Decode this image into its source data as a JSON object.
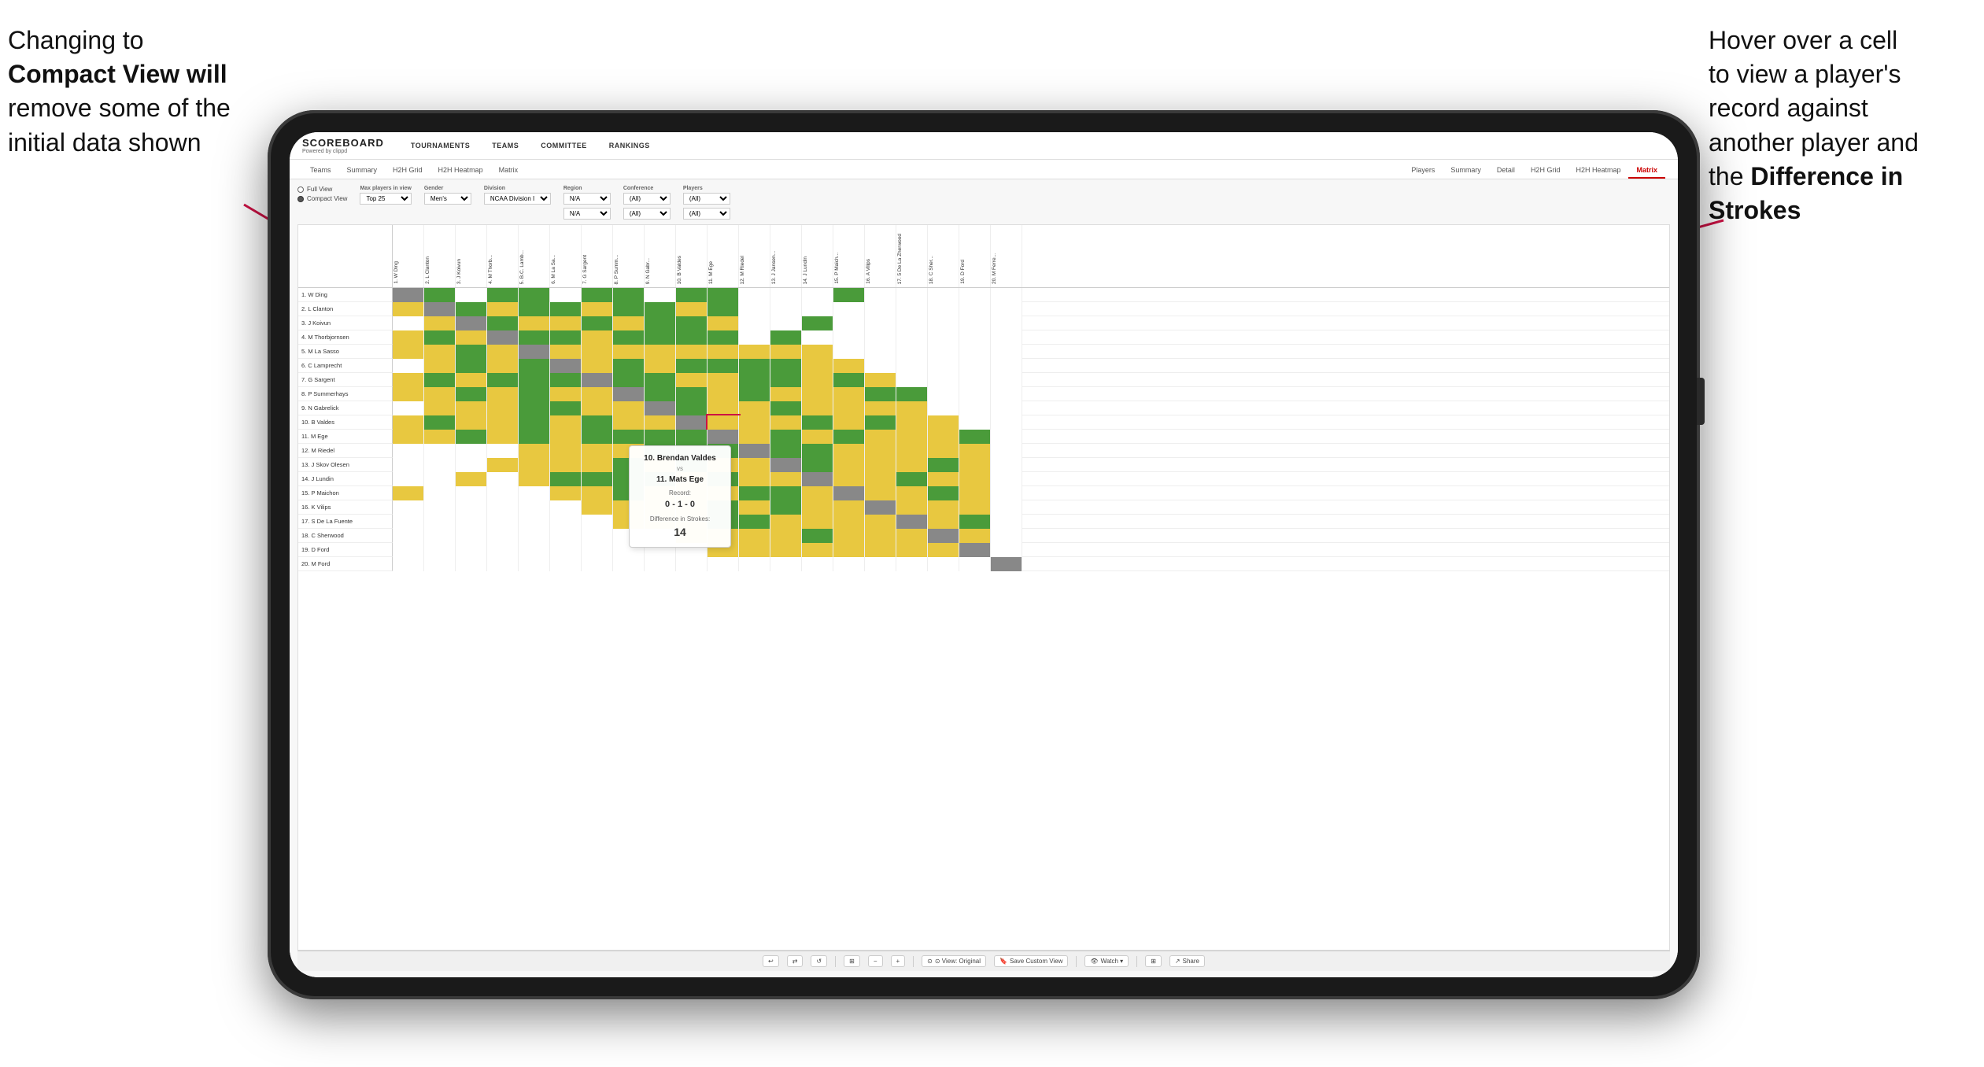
{
  "annotations": {
    "left": {
      "line1": "Changing to",
      "line2": "Compact View will",
      "line3": "remove some of the",
      "line4": "initial data shown"
    },
    "right": {
      "line1": "Hover over a cell",
      "line2": "to view a player's",
      "line3": "record against",
      "line4": "another player and",
      "line5": "the",
      "line6": "Difference in",
      "line7": "Strokes"
    }
  },
  "nav": {
    "logo": "SCOREBOARD",
    "logo_sub": "Powered by clippd",
    "items": [
      "TOURNAMENTS",
      "TEAMS",
      "COMMITTEE",
      "RANKINGS"
    ]
  },
  "sub_nav": {
    "left_tabs": [
      "Teams",
      "Summary",
      "H2H Grid",
      "H2H Heatmap",
      "Matrix"
    ],
    "right_tabs": [
      "Players",
      "Summary",
      "Detail",
      "H2H Grid",
      "H2H Heatmap",
      "Matrix"
    ],
    "active": "Matrix"
  },
  "filters": {
    "view_toggle": {
      "full_view": "Full View",
      "compact_view": "Compact View",
      "selected": "compact"
    },
    "max_players": {
      "label": "Max players in view",
      "value": "Top 25"
    },
    "gender": {
      "label": "Gender",
      "value": "Men's"
    },
    "division": {
      "label": "Division",
      "value": "NCAA Division I"
    },
    "region": {
      "label": "Region",
      "values": [
        "N/A",
        "N/A"
      ]
    },
    "conference": {
      "label": "Conference",
      "values": [
        "(All)",
        "(All)"
      ]
    },
    "players": {
      "label": "Players",
      "values": [
        "(All)",
        "(All)"
      ]
    }
  },
  "players": [
    "1. W Ding",
    "2. L Clanton",
    "3. J Koivun",
    "4. M Thorbjornsen",
    "5. M La Sasso",
    "6. C Lamprecht",
    "7. G Sargent",
    "8. P Summerhays",
    "9. N Gabrelick",
    "10. B Valdes",
    "11. M Ege",
    "12. M Riedel",
    "13. J Skov Olesen",
    "14. J Lundin",
    "15. P Maichon",
    "16. K Vilips",
    "17. S De La Fuente",
    "18. C Sherwood",
    "19. D Ford",
    "20. M Ford"
  ],
  "col_headers": [
    "1. W Ding",
    "2. L Clanton",
    "3. J Koivun",
    "4. M Thorb...",
    "5. M La Sa...",
    "6. C Lamp...",
    "7. G Sargent",
    "8. P Summ...",
    "9. N Gabr...",
    "10. B Valdes",
    "11. M Ege",
    "12. M Riedel",
    "13. J Skov...",
    "14. J Lundin",
    "15. P Maich...",
    "16. K Vilips",
    "17. S De La...",
    "18. C Sher...",
    "19. D Ford",
    "20. M Ford ..."
  ],
  "tooltip": {
    "player1": "10. Brendan Valdes",
    "vs": "vs",
    "player2": "11. Mats Ege",
    "record_label": "Record:",
    "record": "0 - 1 - 0",
    "strokes_label": "Difference in Strokes:",
    "strokes": "14"
  },
  "toolbar": {
    "undo": "↩",
    "redo": "↺",
    "view_original": "⊙ View: Original",
    "save_custom": "🔖 Save Custom View",
    "watch": "👁 Watch ▾",
    "share": "Share"
  }
}
